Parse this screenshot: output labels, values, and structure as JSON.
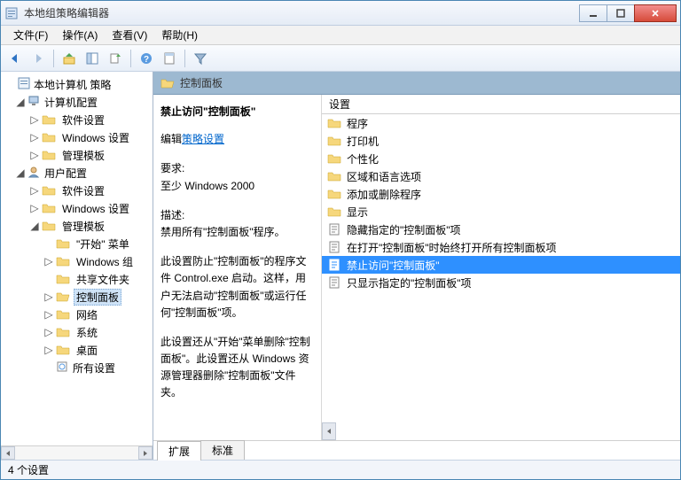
{
  "window": {
    "title": "本地组策略编辑器"
  },
  "menubar": {
    "file": "文件(F)",
    "action": "操作(A)",
    "view": "查看(V)",
    "help": "帮助(H)"
  },
  "tree": {
    "root": "本地计算机 策略",
    "computerConfig": "计算机配置",
    "softwareSettings1": "软件设置",
    "windowsSettings1": "Windows 设置",
    "adminTemplates1": "管理模板",
    "userConfig": "用户配置",
    "softwareSettings2": "软件设置",
    "windowsSettings2": "Windows 设置",
    "adminTemplates2": "管理模板",
    "startMenu": "\"开始\" 菜单",
    "windowsComp": "Windows 组",
    "sharedFolders": "共享文件夹",
    "controlPanel": "控制面板",
    "network": "网络",
    "system": "系统",
    "desktop": "桌面",
    "allSettings": "所有设置"
  },
  "contentHeader": "控制面板",
  "desc": {
    "title": "禁止访问\"控制面板\"",
    "editPrefix": "编辑",
    "editLink": "策略设置",
    "reqLabel": "要求:",
    "reqText": "至少 Windows 2000",
    "descLabel": "描述:",
    "desc1": "禁用所有\"控制面板\"程序。",
    "desc2": "此设置防止\"控制面板\"的程序文件 Control.exe 启动。这样，用户无法启动\"控制面板\"或运行任何\"控制面板\"项。",
    "desc3": "此设置还从\"开始\"菜单删除\"控制面板\"。此设置还从 Windows 资源管理器删除\"控制面板\"文件夹。"
  },
  "settingColHeader": "设置",
  "list": {
    "programs": "程序",
    "printers": "打印机",
    "personalization": "个性化",
    "regionLang": "区域和语言选项",
    "addRemove": "添加或删除程序",
    "display": "显示",
    "hideSpecified": "隐藏指定的\"控制面板\"项",
    "alwaysOpen": "在打开\"控制面板\"时始终打开所有控制面板项",
    "prohibitAccess": "禁止访问\"控制面板\"",
    "showOnly": "只显示指定的\"控制面板\"项"
  },
  "tabs": {
    "extended": "扩展",
    "standard": "标准"
  },
  "status": "4 个设置"
}
